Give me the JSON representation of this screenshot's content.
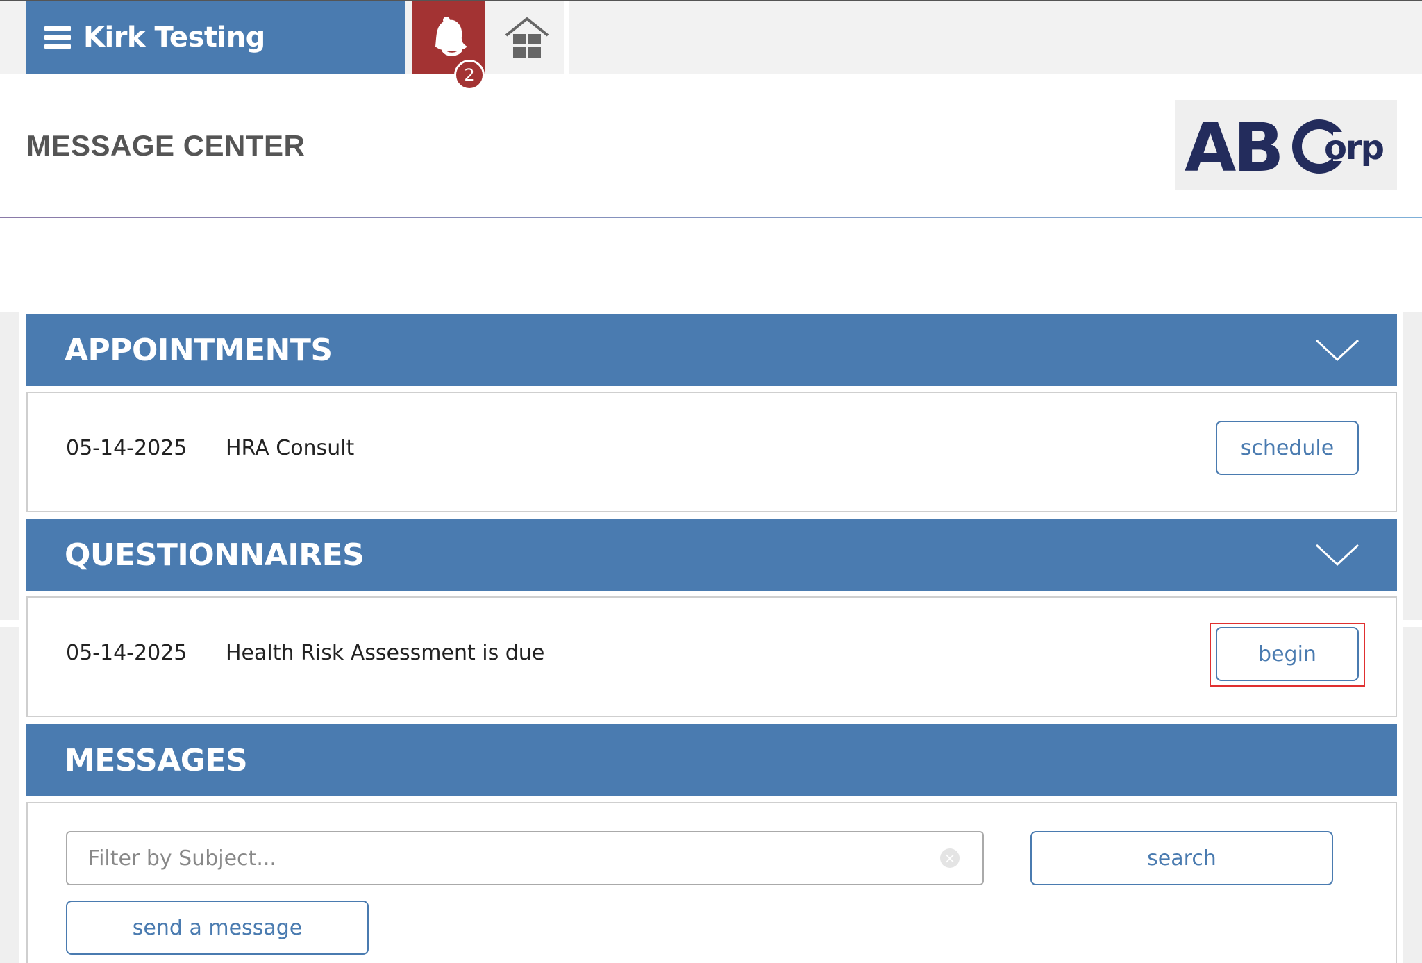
{
  "app": {
    "user_name": "Kirk Testing",
    "notification_count": "2",
    "icons": {
      "menu": "hamburger-menu-icon",
      "notifications": "bell-icon",
      "home": "home-icon"
    }
  },
  "header": {
    "page_title": "MESSAGE CENTER",
    "logo_text_main": "ABC",
    "logo_text_sub": "orp"
  },
  "sections": {
    "appointments": {
      "title": "APPOINTMENTS",
      "items": [
        {
          "date": "05-14-2025",
          "text": "HRA Consult",
          "action_label": "schedule"
        }
      ]
    },
    "questionnaires": {
      "title": "QUESTIONNAIRES",
      "items": [
        {
          "date": "05-14-2025",
          "text": "Health Risk Assessment is due",
          "action_label": "begin"
        }
      ]
    },
    "messages": {
      "title": "MESSAGES",
      "filter_placeholder": "Filter by Subject...",
      "search_label": "search",
      "send_label": "send a message"
    }
  },
  "colors": {
    "primary": "#4a7bb0",
    "alert": "#a33333",
    "highlight": "#e03030"
  }
}
